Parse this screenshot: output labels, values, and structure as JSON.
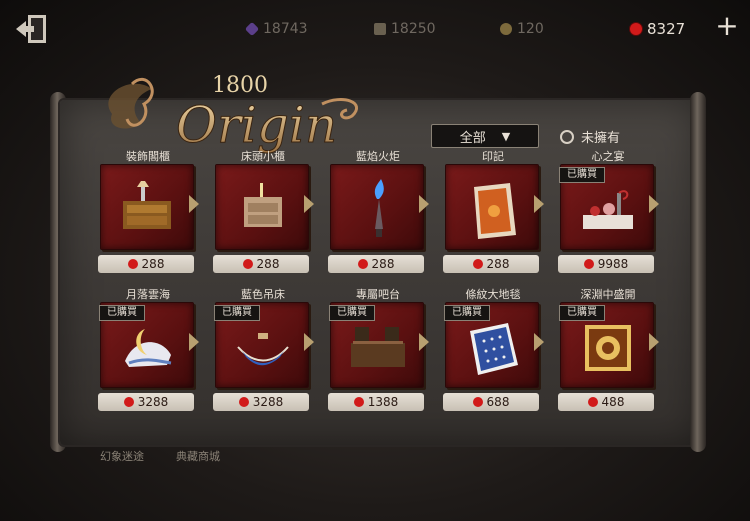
{
  "topbar": {
    "currencies": [
      {
        "id": "purple",
        "value": "18743"
      },
      {
        "id": "puzzle",
        "value": "18250"
      },
      {
        "id": "gold",
        "value": "120"
      },
      {
        "id": "red",
        "value": "8327"
      }
    ],
    "plus_label": "+"
  },
  "logo": {
    "year": "1800",
    "word": "Origin"
  },
  "filter": {
    "selected": "全部",
    "arrow": "▼"
  },
  "owned_toggle": {
    "label": "未擁有"
  },
  "owned_badge": "已購買",
  "items": [
    {
      "name": "裝飾閣櫃",
      "price": "288",
      "owned": false,
      "art": "cabinet"
    },
    {
      "name": "床頭小櫃",
      "price": "288",
      "owned": false,
      "art": "nightstand"
    },
    {
      "name": "藍焰火炬",
      "price": "288",
      "owned": false,
      "art": "torch"
    },
    {
      "name": "印記",
      "price": "288",
      "owned": false,
      "art": "rug-orange"
    },
    {
      "name": "心之宴",
      "price": "9988",
      "owned": true,
      "art": "feast"
    },
    {
      "name": "月落雲海",
      "price": "3288",
      "owned": true,
      "art": "moon-bed"
    },
    {
      "name": "藍色吊床",
      "price": "3288",
      "owned": true,
      "art": "hammock"
    },
    {
      "name": "專屬吧台",
      "price": "1388",
      "owned": true,
      "art": "bar"
    },
    {
      "name": "條紋大地毯",
      "price": "688",
      "owned": true,
      "art": "rug-blue"
    },
    {
      "name": "深淵中盛開",
      "price": "488",
      "owned": true,
      "art": "rug-gold"
    }
  ],
  "bottom_links": [
    "幻象迷途",
    "典藏商城"
  ],
  "colors": {
    "accent_red": "#d11a1a",
    "card_red": "#7a1a1a",
    "panel": "#3e3a37"
  }
}
